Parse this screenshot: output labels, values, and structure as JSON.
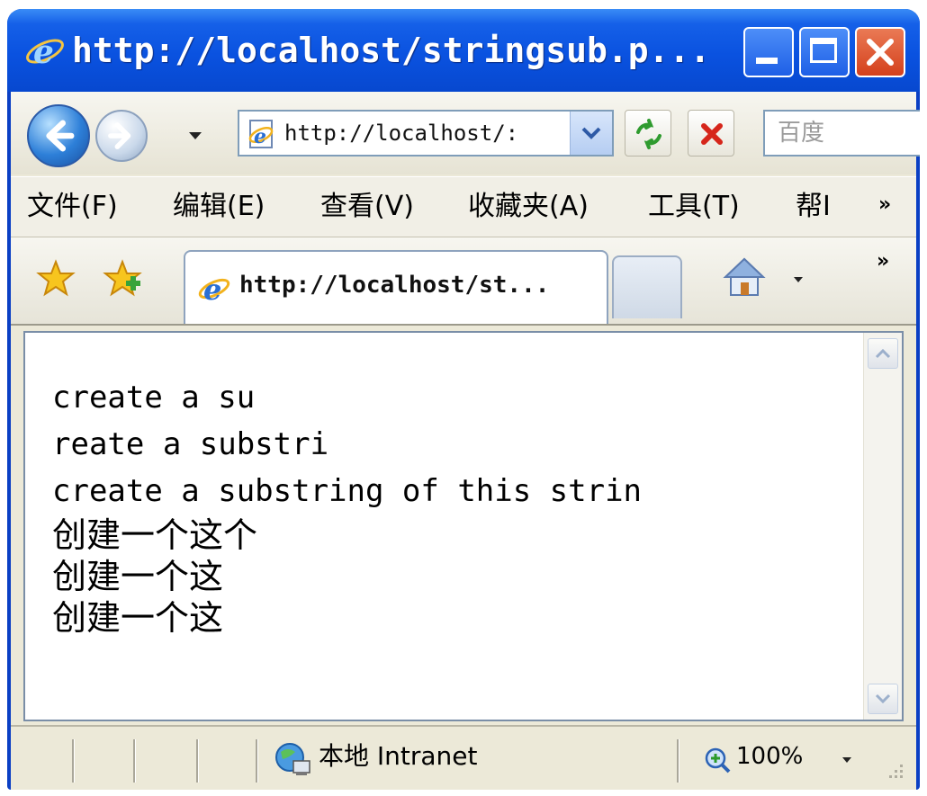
{
  "window": {
    "title": "http://localhost/stringsub.p..."
  },
  "navigation": {
    "address": "http://localhost/:",
    "search_placeholder": "百度"
  },
  "menu": {
    "items": [
      "文件(F)",
      "编辑(E)",
      "查看(V)",
      "收藏夹(A)",
      "工具(T)",
      "帮I"
    ],
    "overflow": "»"
  },
  "tabs": {
    "active_title": "http://localhost/st...",
    "overflow": "»"
  },
  "content": {
    "lines": [
      "create a su",
      "reate a substri",
      "create a substring of this strin",
      "创建一个这个",
      "创建一个这",
      "创建一个这"
    ]
  },
  "status": {
    "zone": "本地 Intranet",
    "zoom": "100%"
  },
  "colors": {
    "titlebar": "#0a52e0",
    "chrome": "#ece9d8",
    "close_button": "#d4401c"
  },
  "icons": {
    "back": "back-arrow-icon",
    "forward": "forward-arrow-icon",
    "refresh": "refresh-icon",
    "stop": "stop-icon",
    "favorites": "favorites-star-icon",
    "add_favorite": "add-favorite-icon",
    "home": "home-icon",
    "zone": "intranet-globe-icon",
    "zoom": "zoom-icon"
  }
}
